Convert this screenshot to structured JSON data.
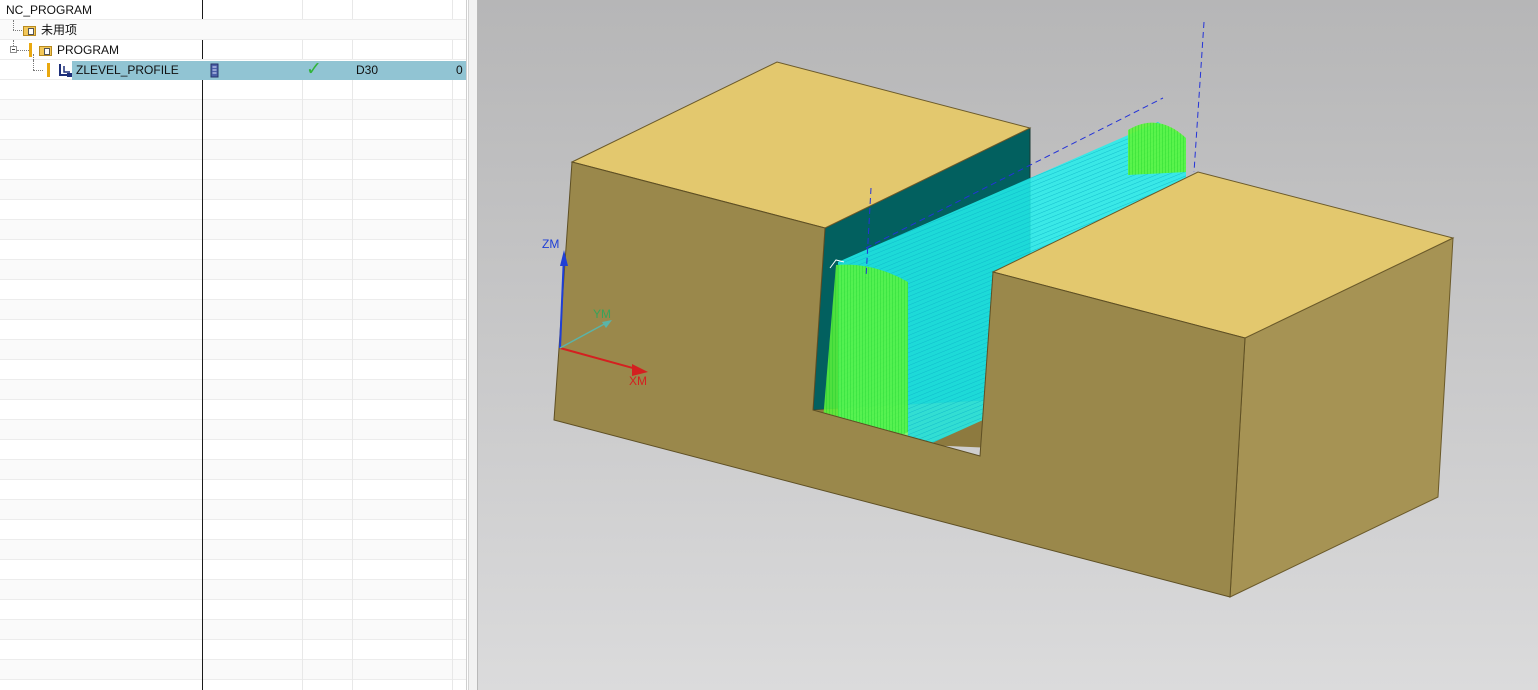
{
  "navigator": {
    "root": {
      "label": "NC_PROGRAM"
    },
    "items": [
      {
        "label": "未用项"
      },
      {
        "label": "PROGRAM"
      },
      {
        "label": "ZLEVEL_PROFILE",
        "status": "✓",
        "tool": "D30",
        "extra": "0"
      }
    ]
  },
  "viewport": {
    "axes": {
      "z": "ZM",
      "y": "YM",
      "x": "XM"
    },
    "colors": {
      "top_face": "#e3c86e",
      "front_face": "#9a884b",
      "side_face": "#a69354",
      "wall_face": "#02605f",
      "toolpath_cyan": "#1ff2ef",
      "toolpath_green": "#38f228",
      "axis_z": "#1f3fd6",
      "axis_x": "#d42020",
      "axis_y": "#3aa35a"
    }
  }
}
